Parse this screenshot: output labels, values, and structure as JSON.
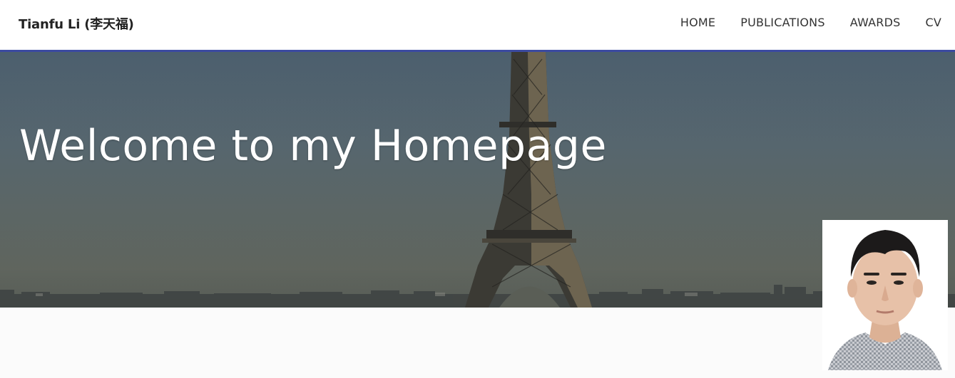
{
  "navbar": {
    "brand": "Tianfu Li (李天福)",
    "links": [
      "HOME",
      "PUBLICATIONS",
      "AWARDS",
      "CV"
    ]
  },
  "hero": {
    "title": "Welcome to my Homepage"
  },
  "colors": {
    "navbar_border": "#3b4aa0",
    "hero_text": "#ffffff",
    "page_background": "#fbfbfb"
  }
}
